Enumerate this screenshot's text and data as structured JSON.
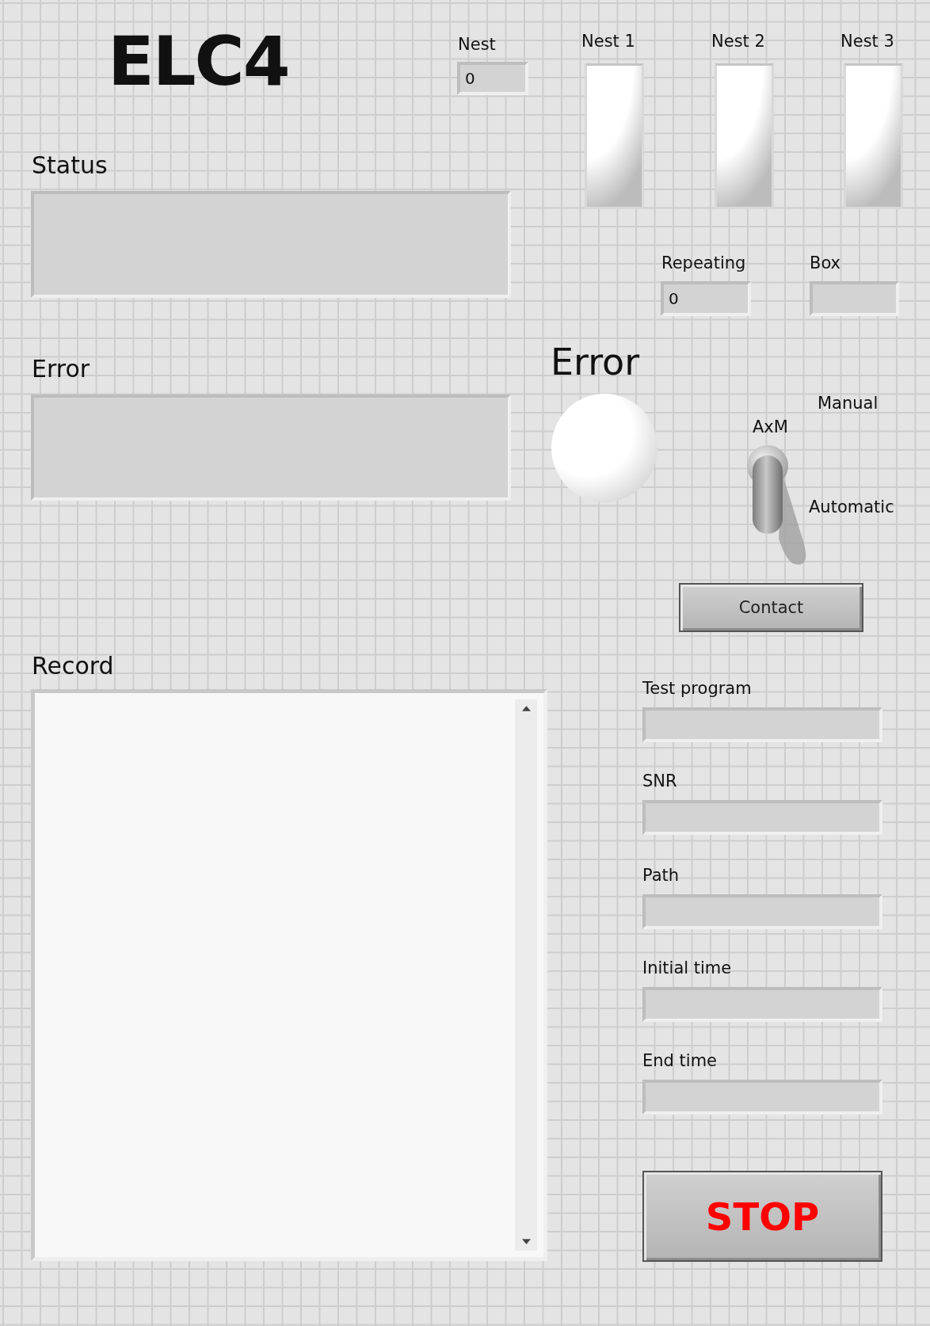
{
  "title": "ELC4",
  "nest": {
    "label": "Nest",
    "value": "0"
  },
  "nest_leds": [
    {
      "label": "Nest 1",
      "on": false
    },
    {
      "label": "Nest 2",
      "on": false
    },
    {
      "label": "Nest 3",
      "on": false
    }
  ],
  "status": {
    "label": "Status"
  },
  "repeating": {
    "label": "Repeating",
    "value": "0"
  },
  "box": {
    "label": "Box"
  },
  "error_message": {
    "label": "Error"
  },
  "error_led": {
    "label": "Error",
    "on": false
  },
  "mode_switch": {
    "label": "AxM",
    "top_label": "Manual",
    "bottom_label": "Automatic",
    "manual": false
  },
  "contact_button": {
    "label": "Contact"
  },
  "record": {
    "label": "Record"
  },
  "info_fields": [
    {
      "label": "Test program"
    },
    {
      "label": "SNR"
    },
    {
      "label": "Path"
    },
    {
      "label": "Initial time"
    },
    {
      "label": "End time"
    }
  ],
  "stop_button": {
    "label": "STOP"
  }
}
